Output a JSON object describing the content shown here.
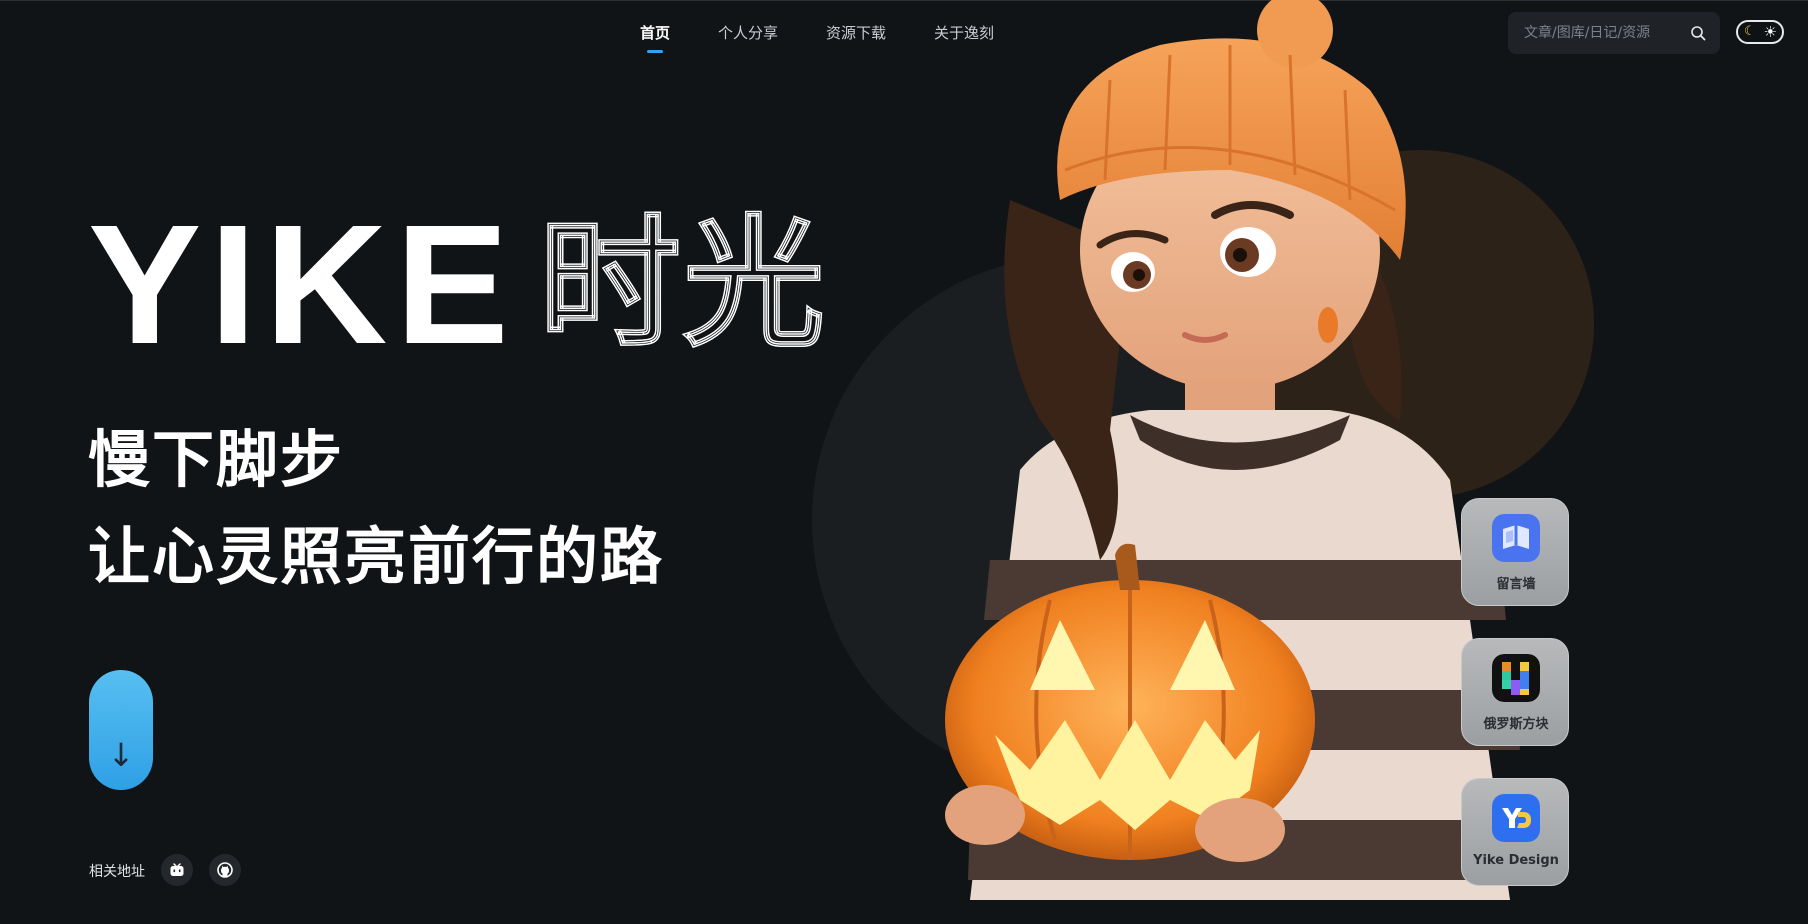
{
  "nav": {
    "items": [
      {
        "label": "首页",
        "active": true
      },
      {
        "label": "个人分享",
        "active": false
      },
      {
        "label": "资源下载",
        "active": false
      },
      {
        "label": "关于逸刻",
        "active": false
      }
    ]
  },
  "search": {
    "placeholder": "文章/图库/日记/资源",
    "icon": "search-icon"
  },
  "theme": {
    "moon_icon": "moon-icon",
    "sun_icon": "sun-icon"
  },
  "hero": {
    "title_solid": "YIKE",
    "title_outline": "时光",
    "slogan_line1": "慢下脚步",
    "slogan_line2": "让心灵照亮前行的路",
    "scroll_icon": "arrow-down-icon",
    "scroll_color": "#4cb4ee"
  },
  "links": {
    "label": "相关地址",
    "items": [
      {
        "icon": "bilibili-icon"
      },
      {
        "icon": "github-icon"
      }
    ]
  },
  "side_apps": [
    {
      "label": "留言墙",
      "icon": "message-wall-icon",
      "color": "#4a73f0"
    },
    {
      "label": "俄罗斯方块",
      "icon": "tetris-icon",
      "color": "#111111"
    },
    {
      "label": "Yike Design",
      "icon": "yike-design-icon",
      "color": "#2e6ff0"
    }
  ],
  "colors": {
    "background": "#111417",
    "accent": "#3aa0e8",
    "halo": "#2c2218"
  }
}
